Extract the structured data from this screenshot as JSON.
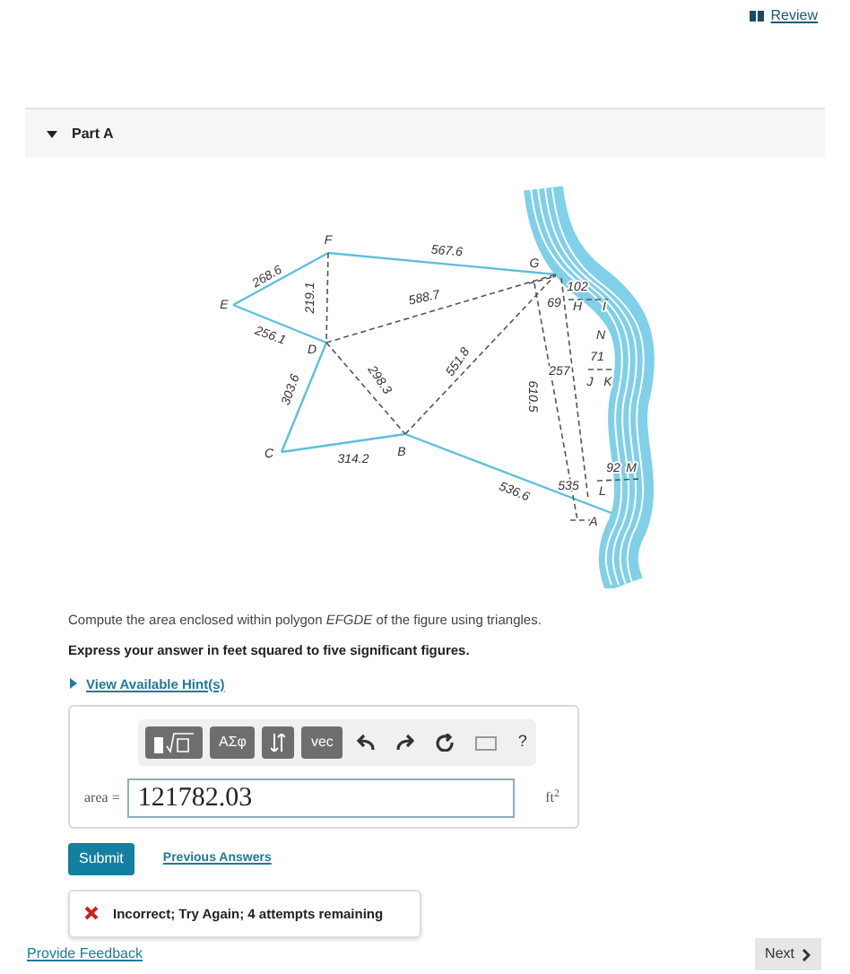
{
  "header": {
    "review_link": "Review"
  },
  "part": {
    "title": "Part A",
    "expanded": true
  },
  "figure": {
    "labels": [
      "E",
      "F",
      "G",
      "D",
      "C",
      "B",
      "A",
      "H",
      "I",
      "N",
      "J",
      "K",
      "L",
      "M",
      "268.6",
      "567.6",
      "219.1",
      "588.7",
      "256.1",
      "303.6",
      "298.3",
      "551.8",
      "610.5",
      "314.2",
      "536.6",
      "69",
      "102",
      "71",
      "257",
      "92",
      "535"
    ]
  },
  "question": {
    "prompt": "Compute the area enclosed within polygon *EFGDE* of the figure using triangles.",
    "instruction": "Express your answer in feet squared to five significant figures.",
    "hints_link": "View Available Hint(s)",
    "hints_expanded": false
  },
  "answer": {
    "symbols_label": "ΑΣφ",
    "vector_label": "vec",
    "help_label": "?",
    "label": "area =",
    "value": "121782.03",
    "unit": "ft$^{2}$"
  },
  "submit": "Submit",
  "previous_answers": "Previous Answers",
  "feedback": {
    "correct": false,
    "message": "Incorrect; Try Again; 4 attempts remaining"
  },
  "footer": {
    "feedback_link": "Provide Feedback",
    "next": "Next"
  }
}
